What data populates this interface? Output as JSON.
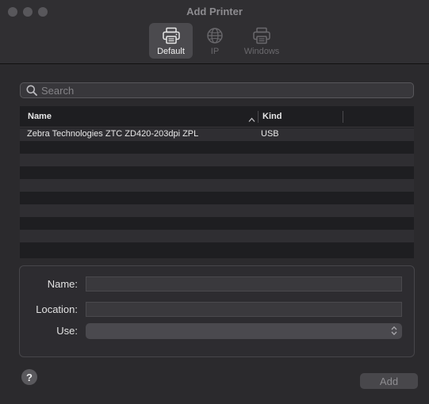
{
  "window": {
    "title": "Add Printer"
  },
  "toolbar": {
    "items": [
      {
        "label": "Default",
        "active": true
      },
      {
        "label": "IP",
        "active": false
      },
      {
        "label": "Windows",
        "active": false
      }
    ]
  },
  "search": {
    "placeholder": "Search",
    "value": ""
  },
  "table": {
    "columns": [
      "Name",
      "Kind"
    ],
    "sort_column": "Name",
    "sort_direction": "ascending",
    "rows": [
      {
        "name": "Zebra Technologies ZTC ZD420-203dpi ZPL",
        "kind": "USB"
      }
    ]
  },
  "details": {
    "name_label": "Name:",
    "name_value": "",
    "location_label": "Location:",
    "location_value": "",
    "use_label": "Use:",
    "use_value": ""
  },
  "buttons": {
    "help": "?",
    "add": "Add"
  },
  "colors": {
    "background": "#2b2a2d",
    "toolbar_active": "#4b4a4e",
    "row_alt": "#2f2e32",
    "table_bg": "#1e1e21"
  }
}
